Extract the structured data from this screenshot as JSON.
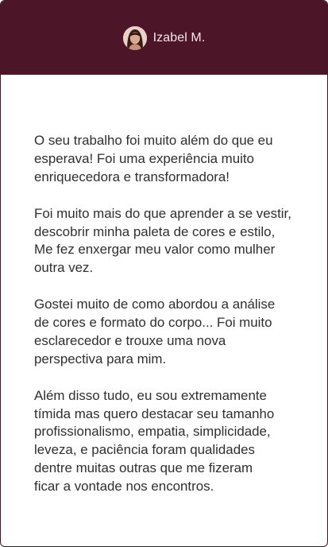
{
  "header": {
    "name": "Izabel M.",
    "avatar_icon": "user-photo-avatar"
  },
  "testimonial": {
    "paragraphs": [
      "O seu trabalho foi muito além do que eu\nesperava! Foi uma experiência muito\nenriquecedora e transformadora!",
      "Foi muito mais do que aprender a se vestir,\ndescobrir minha paleta de cores e estilo,\nMe fez enxergar meu valor como mulher\noutra vez.",
      "Gostei muito de como abordou a análise\nde cores e formato do corpo... Foi muito\nesclarecedor e trouxe uma nova\nperspectiva para mim.",
      "Além disso tudo, eu sou extremamente\ntímida mas quero destacar seu  tamanho\nprofissionalismo, empatia, simplicidade,\nleveza, e paciência foram qualidades\ndentre muitas outras que me fizeram\nficar a vontade nos encontros."
    ]
  },
  "colors": {
    "header_bg": "#4d1528",
    "header_text": "#f3e8ec",
    "body_text": "#2f2f2f",
    "card_bg": "#ffffff"
  }
}
